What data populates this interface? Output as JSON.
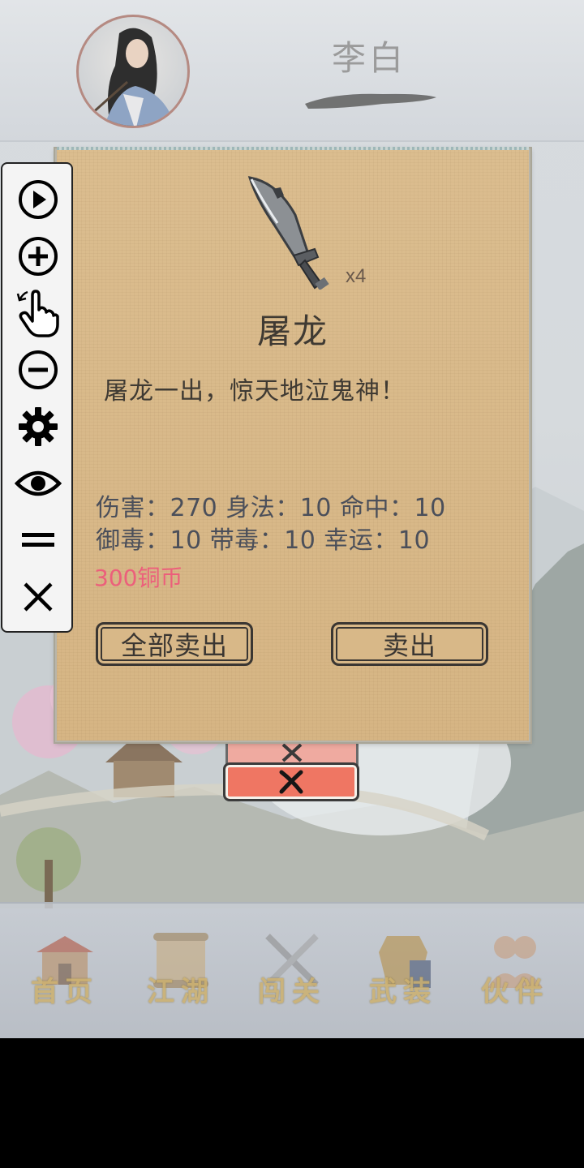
{
  "header": {
    "hero_name": "李白"
  },
  "tool_panel": {
    "buttons": [
      "play-icon",
      "zoom-in-icon",
      "tap-gesture-icon",
      "zoom-out-icon",
      "gear-icon",
      "eye-icon",
      "equals-icon",
      "close-icon"
    ]
  },
  "item_dialog": {
    "count": "x4",
    "name": "屠龙",
    "description": "屠龙一出，惊天地泣鬼神！",
    "stats_line_1": "伤害：270 身法：10 命中：10",
    "stats_line_2": "御毒：10 带毒：10 幸运：10",
    "price": "300铜币",
    "sell_all_label": "全部卖出",
    "sell_label": "卖出"
  },
  "bottom_nav": {
    "items": [
      {
        "label": "首页",
        "icon": "house-icon"
      },
      {
        "label": "江湖",
        "icon": "scroll-icon"
      },
      {
        "label": "闯关",
        "icon": "swords-icon"
      },
      {
        "label": "武装",
        "icon": "armor-icon"
      },
      {
        "label": "伙伴",
        "icon": "companions-icon"
      }
    ]
  },
  "colors": {
    "dialog_bg": "#d8b888",
    "price": "#ec5f7b",
    "close_button": "#ef7663",
    "nav_label": "#cdb16f"
  }
}
